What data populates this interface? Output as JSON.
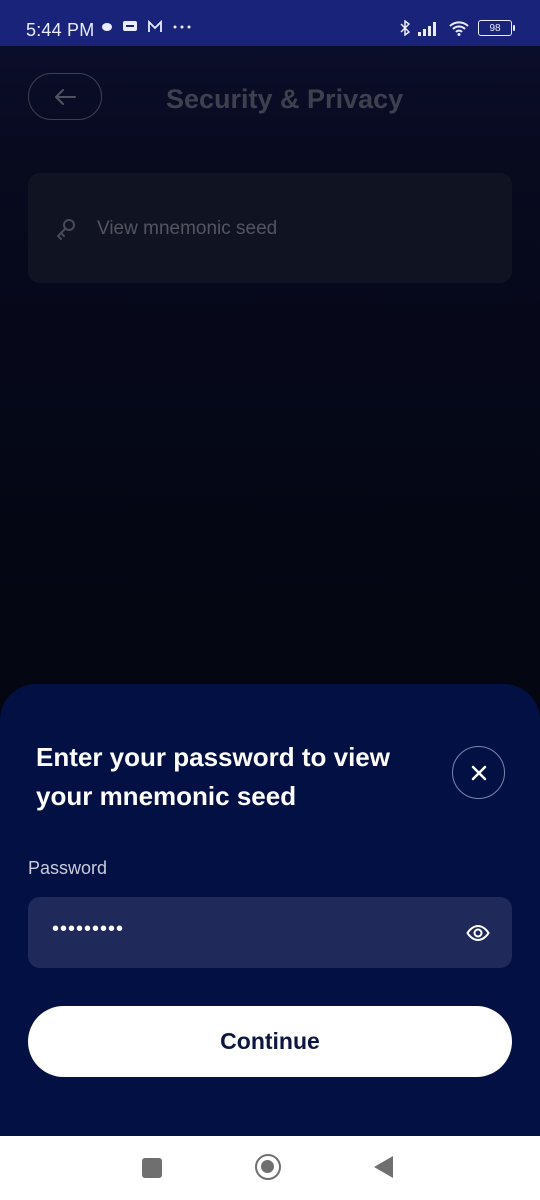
{
  "status_bar": {
    "time": "5:44 PM",
    "icons_left": [
      "notification-icon",
      "message-icon",
      "mail-icon",
      "more-icon"
    ],
    "icons_right": [
      "bluetooth-icon",
      "signal-icon",
      "wifi-icon"
    ],
    "battery": "98"
  },
  "header": {
    "title": "Security & Privacy",
    "back_icon": "arrow-left-icon"
  },
  "options": [
    {
      "label": "View mnemonic seed",
      "icon": "key-icon"
    }
  ],
  "sheet": {
    "title": "Enter your password to view your mnemonic seed",
    "close_icon": "close-icon",
    "password_label": "Password",
    "password_value": "•••••••••",
    "visibility_icon": "eye-icon",
    "continue_label": "Continue"
  },
  "colors": {
    "sheet_bg": "#031044",
    "field_bg": "#1f2a5a",
    "button_bg": "#ffffff",
    "button_text": "#0c1640"
  }
}
